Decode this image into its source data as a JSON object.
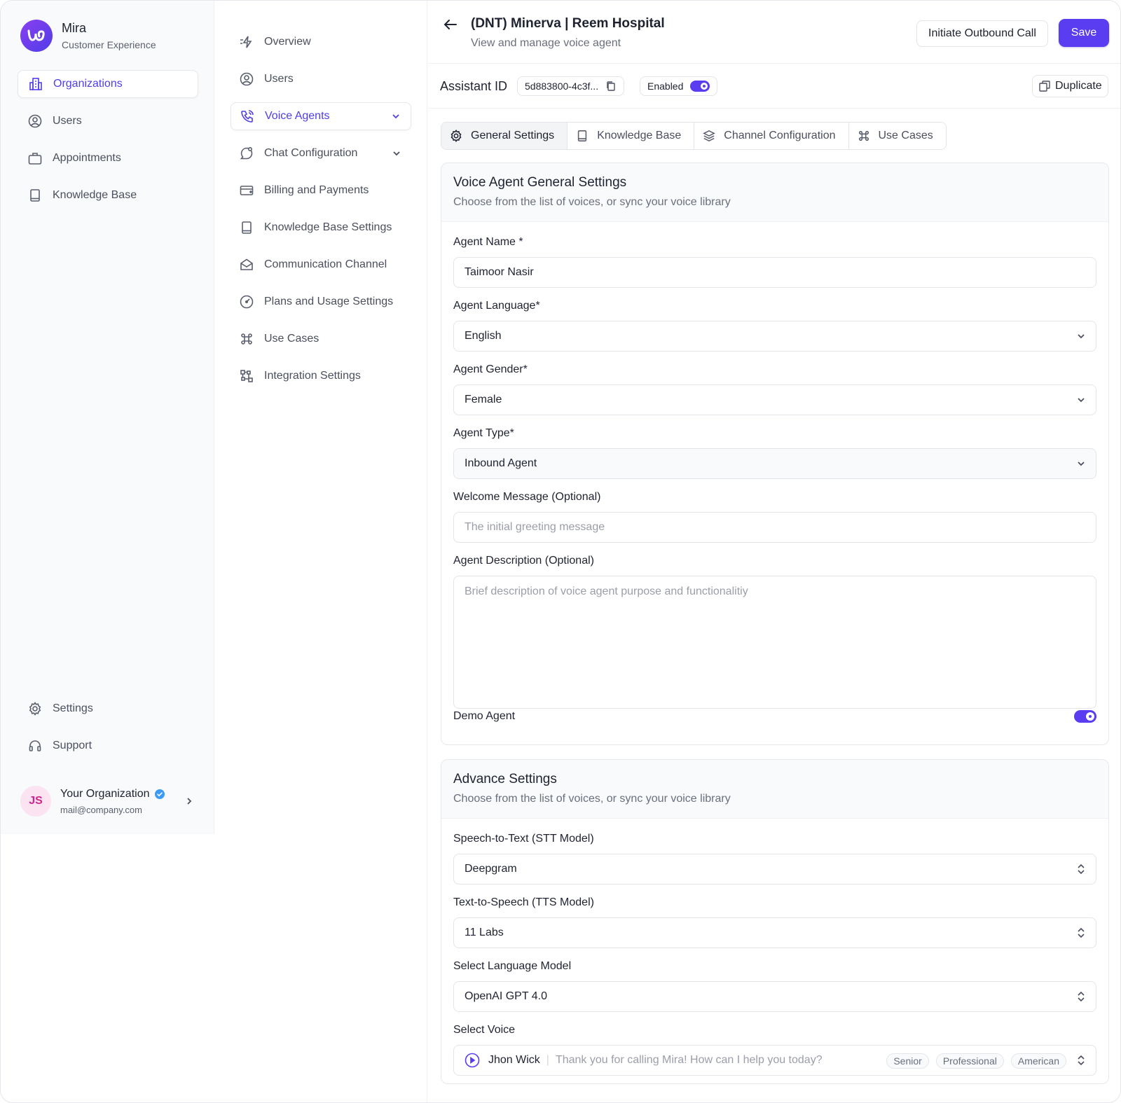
{
  "app": {
    "name": "Mira",
    "subtitle": "Customer Experience"
  },
  "sidebar": {
    "items": [
      {
        "label": "Organizations",
        "icon": "building-icon",
        "active": true
      },
      {
        "label": "Users",
        "icon": "user-circle-icon"
      },
      {
        "label": "Appointments",
        "icon": "briefcase-icon"
      },
      {
        "label": "Knowledge Base",
        "icon": "book-icon"
      }
    ],
    "bottom": [
      {
        "label": "Settings",
        "icon": "gear-icon"
      },
      {
        "label": "Support",
        "icon": "headset-icon"
      }
    ],
    "org": {
      "initials": "JS",
      "name": "Your Organization",
      "email": "mail@company.com"
    }
  },
  "subnav": {
    "items": [
      {
        "label": "Overview",
        "icon": "bolt-icon"
      },
      {
        "label": "Users",
        "icon": "user-circle-icon"
      },
      {
        "label": "Voice Agents",
        "icon": "phone-call-icon",
        "active": true
      },
      {
        "label": "Chat Configuration",
        "icon": "chat-icon"
      },
      {
        "label": "Billing and Payments",
        "icon": "credit-card-icon"
      },
      {
        "label": "Knowledge Base Settings",
        "icon": "book-icon"
      },
      {
        "label": "Communication Channel",
        "icon": "mail-open-icon"
      },
      {
        "label": "Plans and Usage Settings",
        "icon": "gauge-icon"
      },
      {
        "label": "Use Cases",
        "icon": "command-icon"
      },
      {
        "label": "Integration Settings",
        "icon": "integration-icon"
      }
    ]
  },
  "header": {
    "title": "(DNT) Minerva | Reem Hospital",
    "subtitle": "View and manage voice agent",
    "outbound_label": "Initiate Outbound Call",
    "save_label": "Save"
  },
  "assistant": {
    "label": "Assistant ID",
    "id": "5d883800-4c3f...",
    "status": "Enabled",
    "duplicate_label": "Duplicate"
  },
  "tabs": [
    {
      "label": "General Settings",
      "icon": "gear-icon",
      "active": true
    },
    {
      "label": "Knowledge Base",
      "icon": "book-icon"
    },
    {
      "label": "Channel Configuration",
      "icon": "layers-icon"
    },
    {
      "label": "Use Cases",
      "icon": "command-icon"
    }
  ],
  "general": {
    "title": "Voice Agent General Settings",
    "subtitle": "Choose from the list of voices, or sync your voice library",
    "name_label": "Agent Name *",
    "name_value": "Taimoor Nasir",
    "language_label": "Agent Language*",
    "language_value": "English",
    "gender_label": "Agent Gender*",
    "gender_value": "Female",
    "type_label": "Agent Type*",
    "type_value": "Inbound Agent",
    "welcome_label": "Welcome Message (Optional)",
    "welcome_placeholder": "The initial greeting message",
    "desc_label": "Agent Description (Optional)",
    "desc_placeholder": "Brief description of voice agent purpose and functionalitiy",
    "demo_label": "Demo Agent"
  },
  "advance": {
    "title": "Advance Settings",
    "subtitle": "Choose from the list of voices, or sync your voice library",
    "stt_label": "Speech-to-Text (STT Model)",
    "stt_value": "Deepgram",
    "tts_label": "Text-to-Speech (TTS Model)",
    "tts_value": "11 Labs",
    "llm_label": "Select Language Model",
    "llm_value": "OpenAI GPT 4.0",
    "voice_label": "Select Voice",
    "voice_name": "Jhon Wick",
    "voice_sample": "Thank you for calling Mira! How can I help you today?",
    "voice_tags": [
      "Senior",
      "Professional",
      "American"
    ]
  },
  "colors": {
    "accent": "#5a3df0",
    "brand_gradient_start": "#8b3ff0",
    "org_avatar_bg": "#fbe3f1",
    "verified": "#3b9bf5"
  }
}
